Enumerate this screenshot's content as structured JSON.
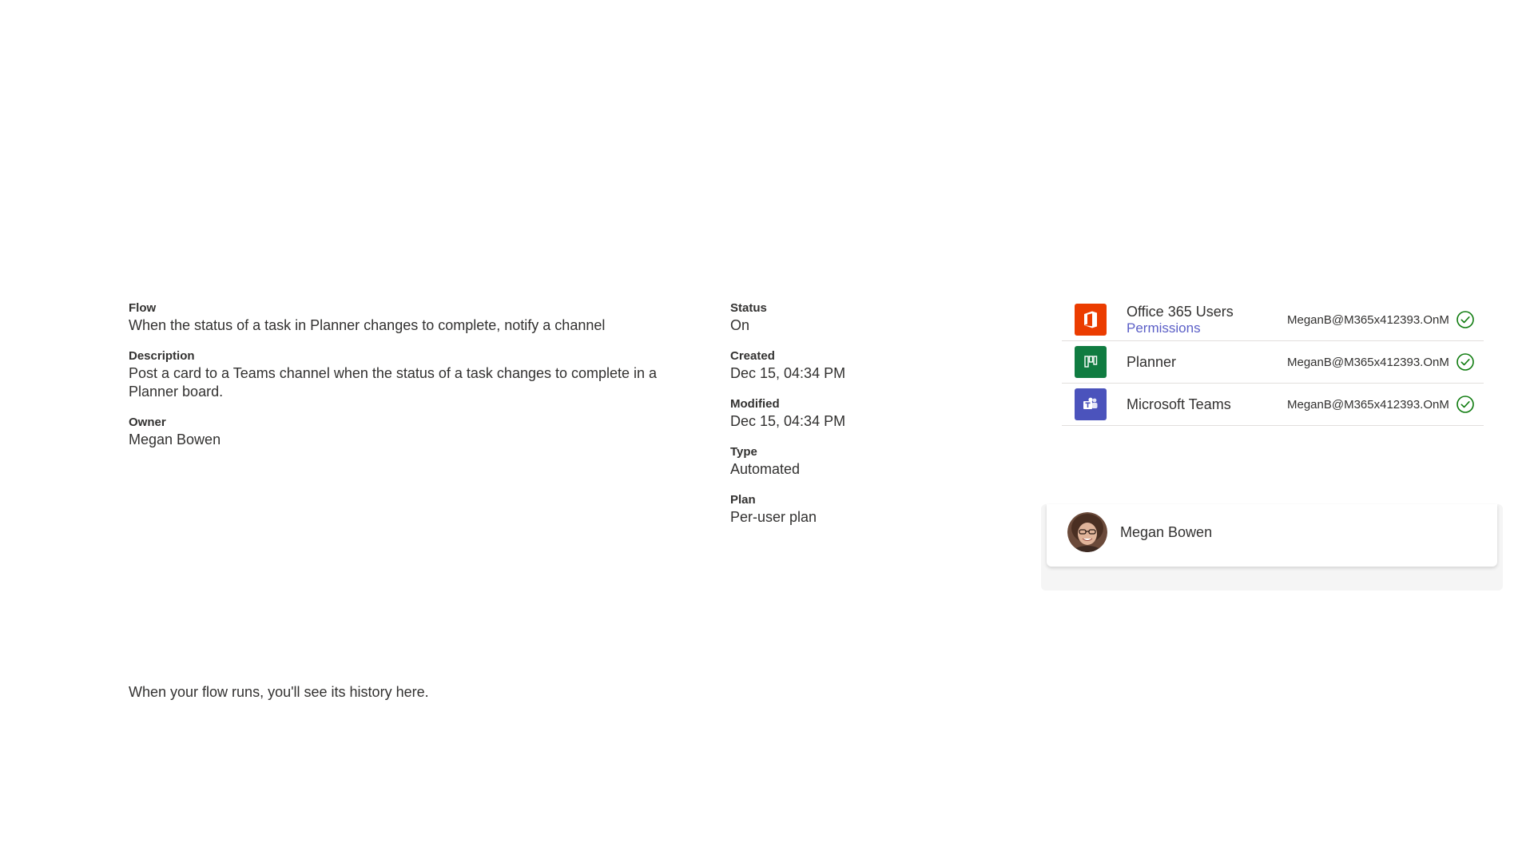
{
  "details": {
    "flow_label": "Flow",
    "flow_value": "When the status of a task in Planner changes to complete, notify a channel",
    "description_label": "Description",
    "description_value": "Post a card to a Teams channel when the status of a task changes to complete in a Planner board.",
    "owner_label": "Owner",
    "owner_value": "Megan Bowen",
    "status_label": "Status",
    "status_value": "On",
    "created_label": "Created",
    "created_value": "Dec 15, 04:34 PM",
    "modified_label": "Modified",
    "modified_value": "Dec 15, 04:34 PM",
    "type_label": "Type",
    "type_value": "Automated",
    "plan_label": "Plan",
    "plan_value": "Per-user plan"
  },
  "connections": [
    {
      "name": "Office 365 Users",
      "link": "Permissions",
      "account": "MeganB@M365x412393.OnM",
      "icon": "office-icon",
      "color": "#eb3c00",
      "status": "connected"
    },
    {
      "name": "Planner",
      "account": "MeganB@M365x412393.OnM",
      "icon": "planner-icon",
      "color": "#107c41",
      "status": "connected"
    },
    {
      "name": "Microsoft Teams",
      "account": "MeganB@M365x412393.OnM",
      "icon": "teams-icon",
      "color": "#4b53bc",
      "status": "connected"
    }
  ],
  "owners": [
    {
      "name": "Megan Bowen"
    }
  ],
  "run_history": {
    "empty_message": "When your flow runs, you'll see its history here."
  },
  "colors": {
    "check": "#107c10",
    "link": "#5b5fc7"
  }
}
